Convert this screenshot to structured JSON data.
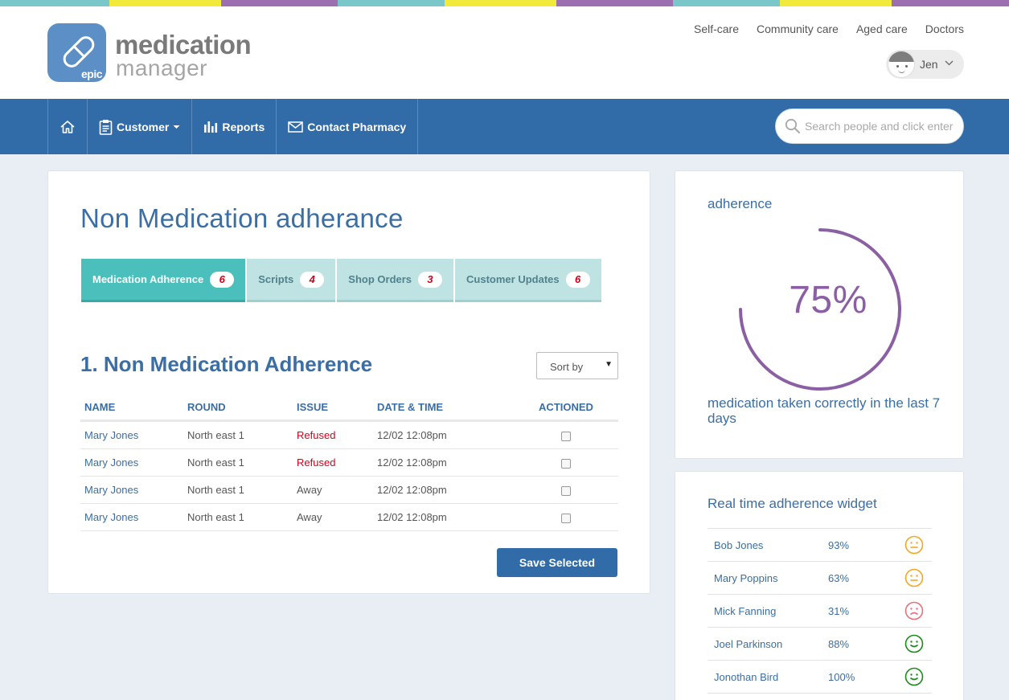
{
  "stripe_colors": [
    "#79c7c9",
    "#f1ea3a",
    "#9b6fb0",
    "#79c7c9",
    "#f1ea3a",
    "#9b6fb0",
    "#79c7c9",
    "#f1ea3a",
    "#9b6fb0"
  ],
  "logo": {
    "word1": "medication",
    "word2": "manager",
    "mark": "epic"
  },
  "top_links": [
    "Self-care",
    "Community care",
    "Aged care",
    "Doctors"
  ],
  "user": {
    "name": "Jen",
    "icon": "user-avatar-icon"
  },
  "nav": {
    "home_icon": "home-icon",
    "items": [
      {
        "label": "Customer",
        "icon": "clipboard-icon",
        "dropdown": true
      },
      {
        "label": "Reports",
        "icon": "bar-chart-icon"
      },
      {
        "label": "Contact Pharmacy",
        "icon": "envelope-icon"
      }
    ],
    "search_placeholder": "Search people and click enter"
  },
  "main": {
    "title": "Non Medication adherance",
    "tabs": [
      {
        "label": "Medication Adherence",
        "count": "6",
        "active": true
      },
      {
        "label": "Scripts",
        "count": "4",
        "active": false
      },
      {
        "label": "Shop Orders",
        "count": "3",
        "active": false
      },
      {
        "label": "Customer Updates",
        "count": "6",
        "active": false
      }
    ],
    "section_title": "1. Non Medication Adherence",
    "sort_label": "Sort by",
    "columns": [
      "NAME",
      "ROUND",
      "ISSUE",
      "DATE & TIME",
      "ACTIONED"
    ],
    "rows": [
      {
        "name": "Mary Jones",
        "round": "North east 1",
        "issue": "Refused",
        "datetime": "12/02 12:08pm",
        "actioned": false
      },
      {
        "name": "Mary Jones",
        "round": "North east 1",
        "issue": "Refused",
        "datetime": "12/02 12:08pm",
        "actioned": false
      },
      {
        "name": "Mary Jones",
        "round": "North east 1",
        "issue": "Away",
        "datetime": "12/02 12:08pm",
        "actioned": false
      },
      {
        "name": "Mary Jones",
        "round": "North east 1",
        "issue": "Away",
        "datetime": "12/02 12:08pm",
        "actioned": false
      }
    ],
    "save_label": "Save Selected"
  },
  "adherence": {
    "title": "adherence",
    "percent_label": "75%",
    "percent_value": 0.75,
    "description": "medication taken correctly in the last 7 days",
    "ring_color": "#8b5fa3"
  },
  "realtime": {
    "title": "Real time adherence widget",
    "rows": [
      {
        "name": "Bob Jones",
        "pct": "93%",
        "mood": "neutral",
        "color": "#f5a623"
      },
      {
        "name": "Mary Poppins",
        "pct": "63%",
        "mood": "neutral",
        "color": "#f5a623"
      },
      {
        "name": "Mick Fanning",
        "pct": "31%",
        "mood": "sad",
        "color": "#e9707a"
      },
      {
        "name": "Joel Parkinson",
        "pct": "88%",
        "mood": "happy",
        "color": "#1a8a1a"
      },
      {
        "name": "Jonothan Bird",
        "pct": "100%",
        "mood": "happy",
        "color": "#1a8a1a"
      }
    ]
  }
}
